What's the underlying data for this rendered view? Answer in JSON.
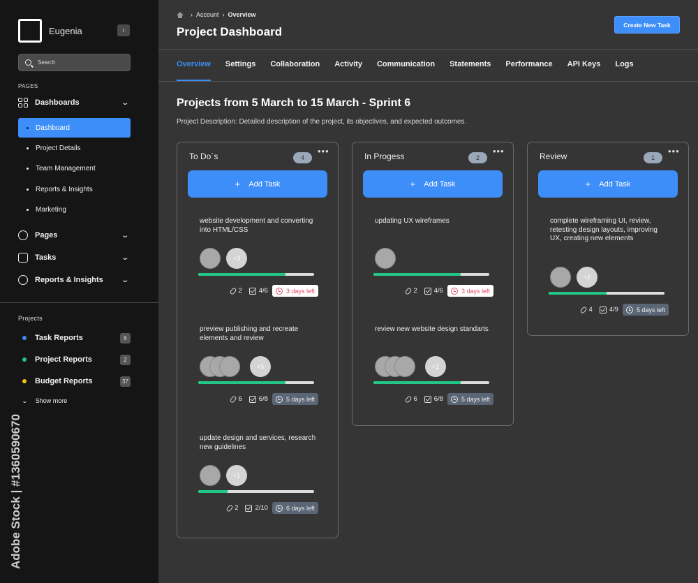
{
  "app": {
    "user_name": "Eugenia",
    "collapse_glyph": "‹"
  },
  "search": {
    "placeholder": "Search"
  },
  "sidebar": {
    "pages_label": "PAGES",
    "groups": [
      {
        "label": "Dashboards",
        "icon": "grid-icon"
      },
      {
        "label": "Pages",
        "icon": "pie-chart-icon"
      },
      {
        "label": "Tasks",
        "icon": "chart-icon"
      },
      {
        "label": "Reports & Insights",
        "icon": "globe-icon"
      }
    ],
    "sub_items": [
      "Dashboard",
      "Project Details",
      "Team Management",
      "Reports & Insights",
      "Marketing"
    ],
    "projects_label": "Projects",
    "projects": [
      {
        "label": "Task Reports",
        "count": "6",
        "color": "#3d8ef8"
      },
      {
        "label": "Project Reports",
        "count": "2",
        "color": "#22c787"
      },
      {
        "label": "Budget Reports",
        "count": "37",
        "color": "#f5c518"
      }
    ],
    "show_more": "Show more"
  },
  "watermark": "Adobe Stock | #1360590670",
  "header": {
    "breadcrumb": [
      "Account",
      "Overview"
    ],
    "title": "Project Dashboard",
    "create_button": "Create New Task"
  },
  "tabs": [
    "Overview",
    "Settings",
    "Collaboration",
    "Activity",
    "Communication",
    "Statements",
    "Performance",
    "API Keys",
    "Logs"
  ],
  "main": {
    "section_title": "Projects from 5 March to 15 March - Sprint 6",
    "description": "Project Description: Detailed description of the project, its objectives, and expected outcomes."
  },
  "add_task_label": "Add Task",
  "columns": [
    {
      "title": "To Do´s",
      "count": "4",
      "cards": [
        {
          "text": "website development and converting into HTML/CSS",
          "avatars": 1,
          "more": "+3",
          "progress": 0.75,
          "attachments": "2",
          "checks": "4/6",
          "due": "3 days left",
          "urgent": true
        },
        {
          "text": "preview publishing and recreate elements and review",
          "avatars": 3,
          "more": "+5",
          "progress": 0.75,
          "attachments": "6",
          "checks": "6/8",
          "due": "5 days left",
          "urgent": false
        },
        {
          "text": "update design and services, research new guidelines",
          "avatars": 1,
          "more": "+1",
          "progress": 0.25,
          "attachments": "2",
          "checks": "2/10",
          "due": "6 days left",
          "urgent": false
        }
      ]
    },
    {
      "title": "In Progess",
      "count": "2",
      "cards": [
        {
          "text": "updating UX wireframes",
          "avatars": 1,
          "more": "",
          "progress": 0.75,
          "attachments": "2",
          "checks": "4/6",
          "due": "3 days left",
          "urgent": true
        },
        {
          "text": "review new website design standarts",
          "avatars": 3,
          "more": "+2",
          "progress": 0.75,
          "attachments": "6",
          "checks": "6/8",
          "due": "5 days left",
          "urgent": false
        }
      ]
    },
    {
      "title": "Review",
      "count": "1",
      "cards": [
        {
          "text": "complete wireframing UI, review, retesting design layouts, improving UX, creating new elements",
          "avatars": 1,
          "more": "+2",
          "progress": 0.5,
          "attachments": "4",
          "checks": "4/9",
          "due": "5 days left",
          "urgent": false
        }
      ]
    }
  ]
}
